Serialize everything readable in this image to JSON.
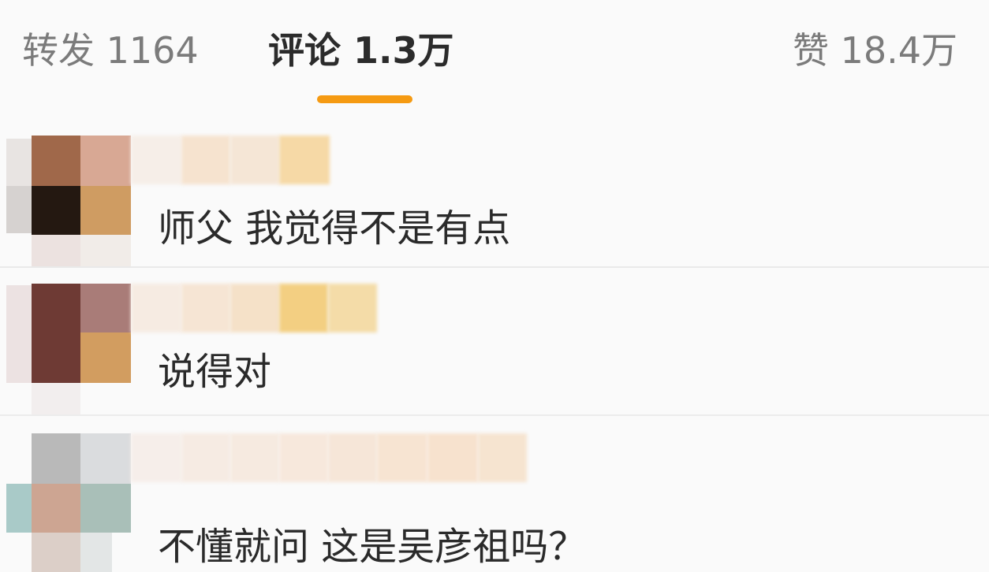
{
  "tabs": {
    "repost": {
      "label": "转发",
      "count": "1164"
    },
    "comments": {
      "label": "评论",
      "count": "1.3万"
    },
    "likes": {
      "label": "赞",
      "count": "18.4万"
    }
  },
  "comments": [
    {
      "text": "师父 我觉得不是有点"
    },
    {
      "text": "说得对"
    },
    {
      "text": "不懂就问 这是吴彦祖吗？"
    }
  ],
  "colors": {
    "accent": "#f59a12"
  }
}
